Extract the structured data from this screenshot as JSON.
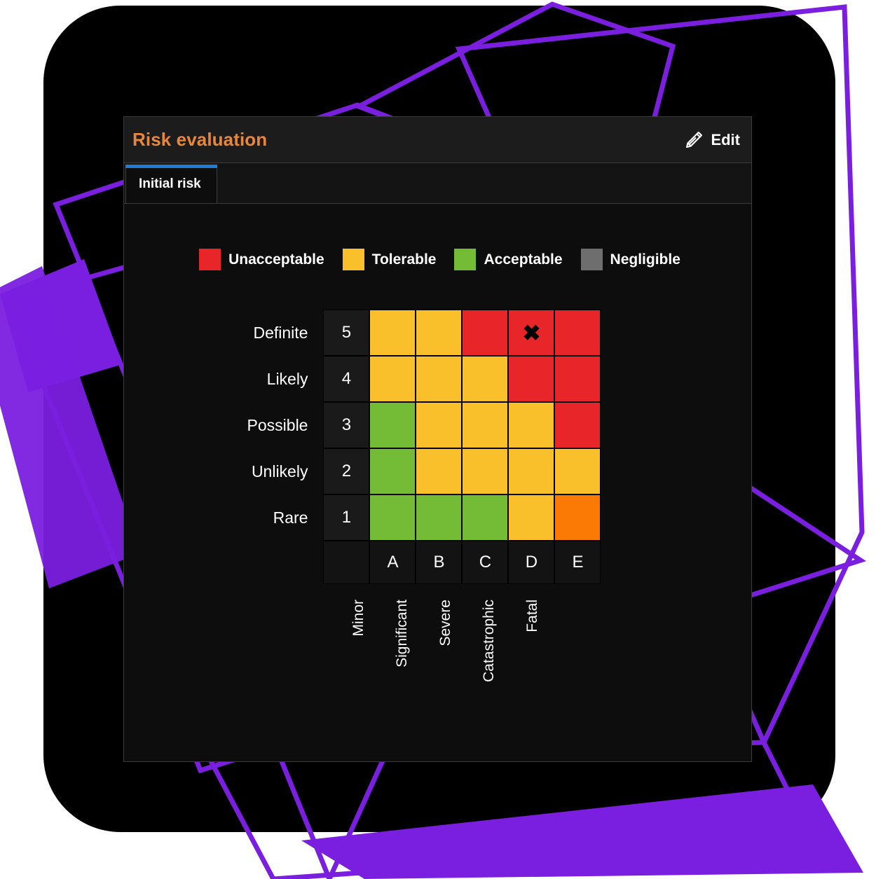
{
  "theme": {
    "page_background": "#ffffff",
    "card_background": "#000000",
    "accent_purple": "#7a1fe0",
    "panel_background": "#0d0d0d",
    "title_color": "#e8873a",
    "tab_active_bar": "#1f7ad4"
  },
  "header": {
    "title": "Risk evaluation",
    "edit_label": "Edit",
    "edit_icon": "pencil-icon"
  },
  "tabs": [
    {
      "label": "Initial risk",
      "active": true
    }
  ],
  "legend": [
    {
      "label": "Unacceptable",
      "color": "#e8262a"
    },
    {
      "label": "Tolerable",
      "color": "#f9c02c"
    },
    {
      "label": "Acceptable",
      "color": "#75bc36"
    },
    {
      "label": "Negligible",
      "color": "#6e6e6e"
    }
  ],
  "chart_data": {
    "type": "heatmap",
    "title": "Risk evaluation",
    "xlabel": "",
    "ylabel": "",
    "grid": true,
    "legend_position": "top",
    "row_labels": [
      "Definite",
      "Likely",
      "Possible",
      "Unlikely",
      "Rare"
    ],
    "row_indices": [
      "5",
      "4",
      "3",
      "2",
      "1"
    ],
    "col_letters": [
      "A",
      "B",
      "C",
      "D",
      "E"
    ],
    "col_labels": [
      "Minor",
      "Significant",
      "Severe",
      "Catastrophic",
      "Fatal"
    ],
    "categories": [
      "Unacceptable",
      "Tolerable",
      "Acceptable",
      "Negligible"
    ],
    "palette": {
      "unacceptable": "#e8262a",
      "tolerable": "#f9c02c",
      "acceptable": "#75bc36",
      "negligible": "#6e6e6e",
      "severe_orange": "#fa7a05"
    },
    "cells": [
      [
        {
          "color": "#f9c02c",
          "level": "Tolerable",
          "marker": ""
        },
        {
          "color": "#f9c02c",
          "level": "Tolerable",
          "marker": ""
        },
        {
          "color": "#e8262a",
          "level": "Unacceptable",
          "marker": ""
        },
        {
          "color": "#e8262a",
          "level": "Unacceptable",
          "marker": "✖"
        },
        {
          "color": "#e8262a",
          "level": "Unacceptable",
          "marker": ""
        }
      ],
      [
        {
          "color": "#f9c02c",
          "level": "Tolerable",
          "marker": ""
        },
        {
          "color": "#f9c02c",
          "level": "Tolerable",
          "marker": ""
        },
        {
          "color": "#f9c02c",
          "level": "Tolerable",
          "marker": ""
        },
        {
          "color": "#e8262a",
          "level": "Unacceptable",
          "marker": ""
        },
        {
          "color": "#e8262a",
          "level": "Unacceptable",
          "marker": ""
        }
      ],
      [
        {
          "color": "#75bc36",
          "level": "Acceptable",
          "marker": ""
        },
        {
          "color": "#f9c02c",
          "level": "Tolerable",
          "marker": ""
        },
        {
          "color": "#f9c02c",
          "level": "Tolerable",
          "marker": ""
        },
        {
          "color": "#f9c02c",
          "level": "Tolerable",
          "marker": ""
        },
        {
          "color": "#e8262a",
          "level": "Unacceptable",
          "marker": ""
        }
      ],
      [
        {
          "color": "#75bc36",
          "level": "Acceptable",
          "marker": ""
        },
        {
          "color": "#f9c02c",
          "level": "Tolerable",
          "marker": ""
        },
        {
          "color": "#f9c02c",
          "level": "Tolerable",
          "marker": ""
        },
        {
          "color": "#f9c02c",
          "level": "Tolerable",
          "marker": ""
        },
        {
          "color": "#f9c02c",
          "level": "Tolerable",
          "marker": ""
        }
      ],
      [
        {
          "color": "#75bc36",
          "level": "Acceptable",
          "marker": ""
        },
        {
          "color": "#75bc36",
          "level": "Acceptable",
          "marker": ""
        },
        {
          "color": "#75bc36",
          "level": "Acceptable",
          "marker": ""
        },
        {
          "color": "#f9c02c",
          "level": "Tolerable",
          "marker": ""
        },
        {
          "color": "#fa7a05",
          "level": "Tolerable",
          "marker": ""
        }
      ]
    ],
    "selected_cell": {
      "row_label": "Definite",
      "row_index": "5",
      "col_letter": "D",
      "col_label": "Catastrophic",
      "level": "Unacceptable"
    }
  }
}
